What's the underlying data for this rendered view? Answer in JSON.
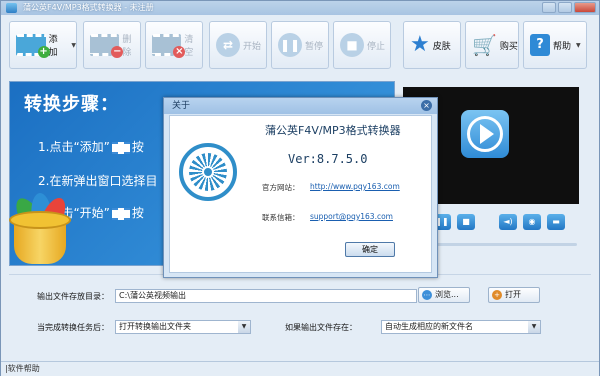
{
  "window": {
    "title": "蒲公英F4V/MP3格式转换器 - 未注册"
  },
  "toolbar": {
    "add": "添加",
    "delete": "删除",
    "clear": "清空",
    "start": "开始",
    "pause": "暂停",
    "stop": "停止",
    "skin": "皮肤",
    "buy": "购买",
    "help": "帮助"
  },
  "steps": {
    "title": "转换步骤：",
    "step1": "1.点击“添加”",
    "step1_tail": "按",
    "step2": "2.在新弹出窗口选择目",
    "step3": "3.点击“开始”",
    "step3_tail": "按"
  },
  "settings": {
    "output_dir_label": "输出文件存放目录：",
    "output_dir_value": "C:\\蒲公英视频输出",
    "browse": "浏览...",
    "open": "打开",
    "after_done_label": "当完成转换任务后：",
    "after_done_value": "打开转换输出文件夹",
    "if_exists_label": "如果输出文件存在：",
    "if_exists_value": "自动生成相应的新文件名"
  },
  "statusbar": {
    "text": "|软件帮助"
  },
  "about": {
    "title": "关于",
    "app_name": "蒲公英F4V/MP3格式转换器",
    "version": "Ver:8.7.5.0",
    "website_label": "官方网站：",
    "website": "http://www.pqy163.com",
    "email_label": "联系信箱：",
    "email": "support@pqy163.com",
    "ok": "确定"
  }
}
